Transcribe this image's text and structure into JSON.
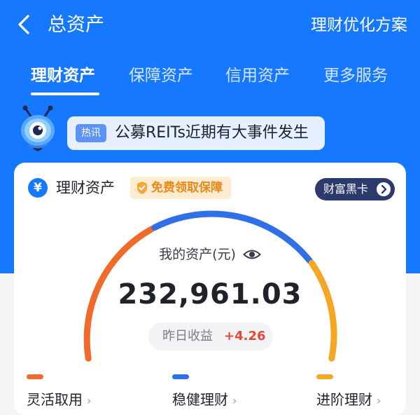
{
  "header": {
    "title": "总资产",
    "right_action": "理财优化方案"
  },
  "tabs": [
    {
      "label": "理财资产",
      "active": true
    },
    {
      "label": "保障资产",
      "active": false
    },
    {
      "label": "信用资产",
      "active": false
    },
    {
      "label": "更多服务",
      "active": false
    }
  ],
  "news": {
    "tag": "热讯",
    "text": "公募REITs近期有大事件发生"
  },
  "card": {
    "title": "理财资产",
    "promo": "免费领取保障",
    "black_card": "财富黑卡",
    "assets_label": "我的资产(元)",
    "amount": "232,961.03",
    "yesterday_label": "昨日收益",
    "yesterday_value": "+4.26",
    "legend": [
      {
        "label": "灵活取用",
        "color": "#f06a2c"
      },
      {
        "label": "稳健理财",
        "color": "#2f6fe8"
      },
      {
        "label": "进阶理财",
        "color": "#f5a623"
      }
    ]
  },
  "colors": {
    "primary_blue": "#1677ff",
    "flexible": "#f06a2c",
    "stable": "#2f6fe8",
    "advanced": "#f5a623",
    "gain_red": "#e8463a"
  }
}
